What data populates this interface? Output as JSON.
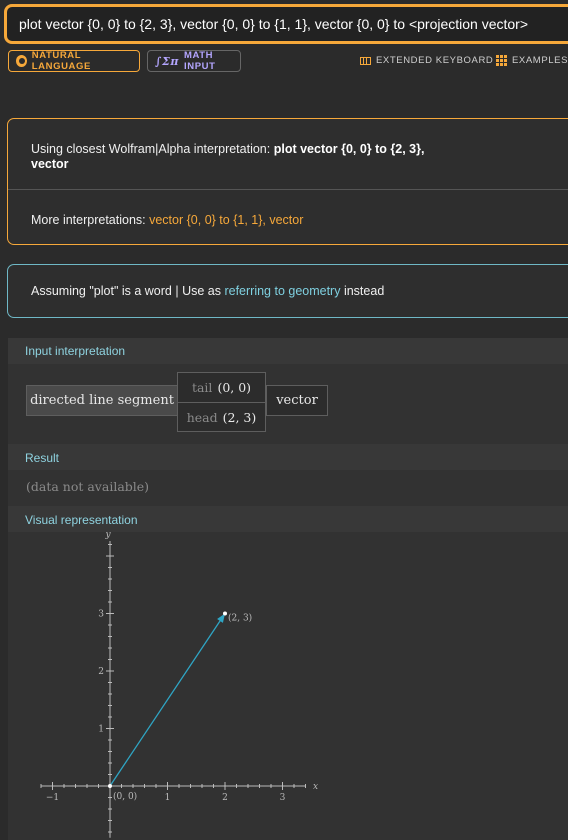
{
  "query": "plot vector {0, 0} to {2, 3}, vector {0, 0} to {1, 1}, vector {0, 0} to <projection vector>",
  "modes": {
    "natural_language": "NATURAL LANGUAGE",
    "math_input": "MATH INPUT",
    "math_glyph": "∫Σπ"
  },
  "links": {
    "extended_keyboard": "EXTENDED KEYBOARD",
    "examples": "EXAMPLES"
  },
  "interpretation": {
    "prefix": "Using closest Wolfram|Alpha interpretation: ",
    "bold": "plot vector {0, 0} to {2, 3}, vector",
    "more_label": "More interpretations: ",
    "more_link": "vector {0, 0} to {1, 1}, vector"
  },
  "assumption": {
    "prefix": "Assuming \"plot\" is a word | Use as ",
    "link": "referring to geometry",
    "suffix": " instead"
  },
  "pods": {
    "input_title": "Input interpretation",
    "segment": "directed line segment",
    "tail_label": "tail",
    "tail_value": "(0, 0)",
    "head_label": "head",
    "head_value": "(2, 3)",
    "vector": "vector",
    "result_title": "Result",
    "result_value": "(data not available)",
    "visual_title": "Visual representation"
  },
  "colors": {
    "accent": "#f6a83a",
    "vector_line": "#2fa5c4",
    "link_teal": "#7fd0e0"
  },
  "chart_data": {
    "type": "line",
    "xlabel": "x",
    "ylabel": "y",
    "xlim": [
      -1.2,
      3.6
    ],
    "ylim": [
      -0.9,
      4.4
    ],
    "xticks": [
      "-1",
      "1",
      "2",
      "3"
    ],
    "yticks": [
      "1",
      "2",
      "3"
    ],
    "series": [
      {
        "x": [
          0,
          2
        ],
        "y": [
          0,
          3
        ]
      }
    ],
    "annotations": [
      {
        "text": "(2, 3)",
        "x": 2,
        "y": 3
      },
      {
        "text": "(0, 0)",
        "x": 0,
        "y": 0
      }
    ]
  }
}
